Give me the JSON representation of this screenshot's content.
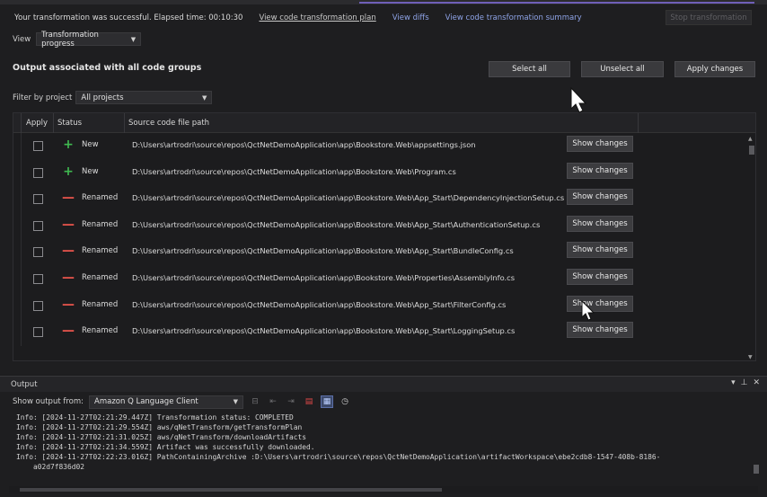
{
  "header": {
    "status_text": "Your transformation was successful. Elapsed time: 00:10:30",
    "link_plan": "View code transformation plan",
    "link_diffs": "View diffs",
    "link_summary": "View code transformation summary",
    "stop_button": "Stop transformation"
  },
  "view": {
    "label": "View",
    "selected": "Transformation progress"
  },
  "section": {
    "title": "Output associated with all code groups",
    "select_all": "Select all",
    "unselect_all": "Unselect all",
    "apply_changes": "Apply changes"
  },
  "filter": {
    "label": "Filter by project",
    "selected": "All projects"
  },
  "table": {
    "columns": [
      "Apply",
      "Status",
      "Source code file path"
    ],
    "show_changes_label": "Show changes",
    "rows": [
      {
        "status": "New",
        "icon": "plus-icon",
        "path": "D:\\Users\\artrodri\\source\\repos\\QctNetDemoApplication\\app\\Bookstore.Web\\appsettings.json"
      },
      {
        "status": "New",
        "icon": "plus-icon",
        "path": "D:\\Users\\artrodri\\source\\repos\\QctNetDemoApplication\\app\\Bookstore.Web\\Program.cs"
      },
      {
        "status": "Renamed",
        "icon": "minus-icon",
        "path": "D:\\Users\\artrodri\\source\\repos\\QctNetDemoApplication\\app\\Bookstore.Web\\App_Start\\DependencyInjectionSetup.cs"
      },
      {
        "status": "Renamed",
        "icon": "minus-icon",
        "path": "D:\\Users\\artrodri\\source\\repos\\QctNetDemoApplication\\app\\Bookstore.Web\\App_Start\\AuthenticationSetup.cs"
      },
      {
        "status": "Renamed",
        "icon": "minus-icon",
        "path": "D:\\Users\\artrodri\\source\\repos\\QctNetDemoApplication\\app\\Bookstore.Web\\App_Start\\BundleConfig.cs"
      },
      {
        "status": "Renamed",
        "icon": "minus-icon",
        "path": "D:\\Users\\artrodri\\source\\repos\\QctNetDemoApplication\\app\\Bookstore.Web\\Properties\\AssemblyInfo.cs"
      },
      {
        "status": "Renamed",
        "icon": "minus-icon",
        "path": "D:\\Users\\artrodri\\source\\repos\\QctNetDemoApplication\\app\\Bookstore.Web\\App_Start\\FilterConfig.cs"
      },
      {
        "status": "Renamed",
        "icon": "minus-icon",
        "path": "D:\\Users\\artrodri\\source\\repos\\QctNetDemoApplication\\app\\Bookstore.Web\\App_Start\\LoggingSetup.cs"
      }
    ]
  },
  "output": {
    "title": "Output",
    "show_from_label": "Show output from:",
    "source": "Amazon Q Language Client",
    "log": [
      "Info: [2024-11-27T02:21:29.447Z] Transformation status: COMPLETED",
      "Info: [2024-11-27T02:21:29.554Z] aws/qNetTransform/getTransformPlan",
      "Info: [2024-11-27T02:21:31.025Z] aws/qNetTransform/downloadArtifacts",
      "Info: [2024-11-27T02:21:34.559Z] Artifact was successfully downloaded.",
      "Info: [2024-11-27T02:22:23.016Z] PathContainingArchive :D:\\Users\\artrodri\\source\\repos\\QctNetDemoApplication\\artifactWorkspace\\ebe2cdb8-1547-408b-8186-",
      "    a02d7f836d02"
    ]
  },
  "colors": {
    "accent": "#6f5fb8",
    "new": "#3fb950",
    "renamed": "#e5534b",
    "link": "#8ea3e6"
  }
}
